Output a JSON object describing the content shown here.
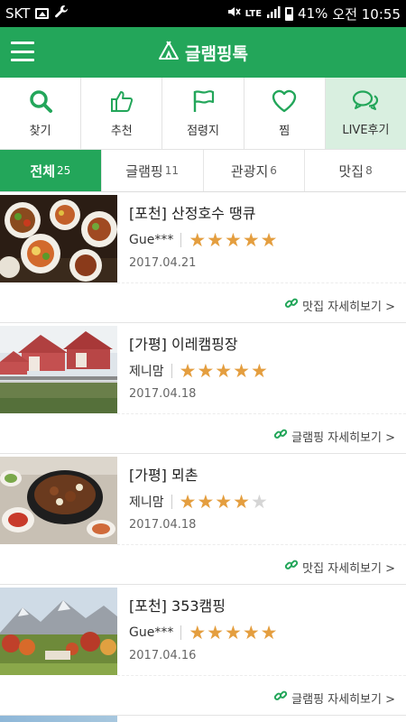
{
  "status_bar": {
    "carrier": "SKT",
    "network": "LTE",
    "battery": "41%",
    "time": "오전 10:55"
  },
  "header": {
    "title": "글램핑톡",
    "accent": "#23a65a"
  },
  "nav": [
    {
      "label": "찾기",
      "icon": "search-icon"
    },
    {
      "label": "추천",
      "icon": "thumbs-up-icon"
    },
    {
      "label": "점령지",
      "icon": "flag-icon"
    },
    {
      "label": "찜",
      "icon": "heart-icon"
    },
    {
      "label": "LIVE후기",
      "icon": "chat-bubbles-icon",
      "active": true
    }
  ],
  "tabs": [
    {
      "label": "전체",
      "count": "25",
      "active": true
    },
    {
      "label": "글램핑",
      "count": "11"
    },
    {
      "label": "관광지",
      "count": "6"
    },
    {
      "label": "맛집",
      "count": "8"
    }
  ],
  "reviews": [
    {
      "title": "[포천] 산정호수 땡큐",
      "author": "Gue***",
      "rating": 5,
      "date": "2017.04.21",
      "link": "맛집 자세히보기 >",
      "thumb": "food"
    },
    {
      "title": "[가평] 이레캠핑장",
      "author": "제니맘",
      "rating": 5,
      "date": "2017.04.18",
      "link": "글램핑 자세히보기 >",
      "thumb": "tents"
    },
    {
      "title": "[가평] 뫼촌",
      "author": "제니맘",
      "rating": 4,
      "date": "2017.04.18",
      "link": "맛집 자세히보기 >",
      "thumb": "bbq"
    },
    {
      "title": "[포천] 353캠핑",
      "author": "Gue***",
      "rating": 5,
      "date": "2017.04.16",
      "link": "글램핑 자세히보기 >",
      "thumb": "mountain"
    }
  ]
}
